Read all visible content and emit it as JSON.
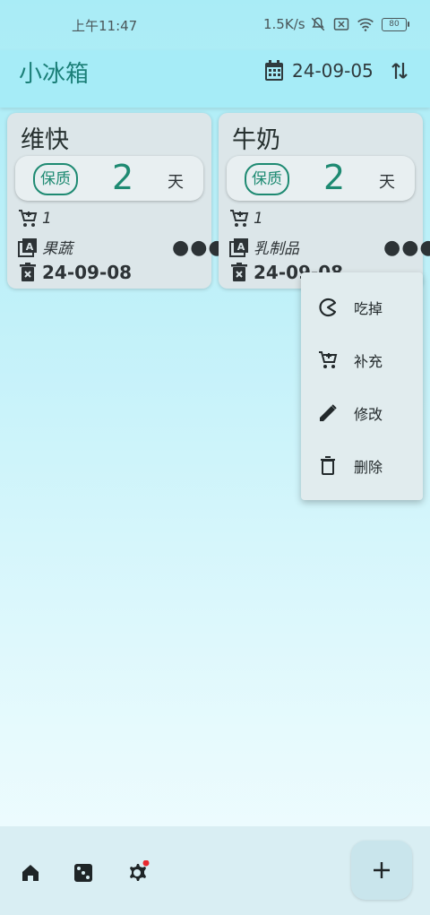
{
  "status_bar": {
    "time": "上午11:47",
    "network_speed": "1.5K/s",
    "battery": "80"
  },
  "app_bar": {
    "title": "小冰箱",
    "date": "24-09-05",
    "icons": [
      "calendar-icon",
      "sort-icon"
    ]
  },
  "items": [
    {
      "name": "维快",
      "shelf_tag": "保质",
      "shelf_days": "2",
      "shelf_unit": "天",
      "quantity": "1",
      "category": "果蔬",
      "expire_date": "24-09-08"
    },
    {
      "name": "牛奶",
      "shelf_tag": "保质",
      "shelf_days": "2",
      "shelf_unit": "天",
      "quantity": "1",
      "category": "乳制品",
      "expire_date": "24-09-08"
    }
  ],
  "context_menu": {
    "items": [
      {
        "label": "吃掉",
        "icon": "eat-icon"
      },
      {
        "label": "补充",
        "icon": "cart-add-icon"
      },
      {
        "label": "修改",
        "icon": "pencil-icon"
      },
      {
        "label": "删除",
        "icon": "trash-icon"
      }
    ]
  },
  "bottom_nav": {
    "icons": [
      "home-icon",
      "dice-icon",
      "settings-icon"
    ],
    "fab_icon": "plus-icon"
  },
  "colors": {
    "accent": "#1e8a72",
    "appbar": "#a6ecf7",
    "card": "#dce6e9"
  }
}
